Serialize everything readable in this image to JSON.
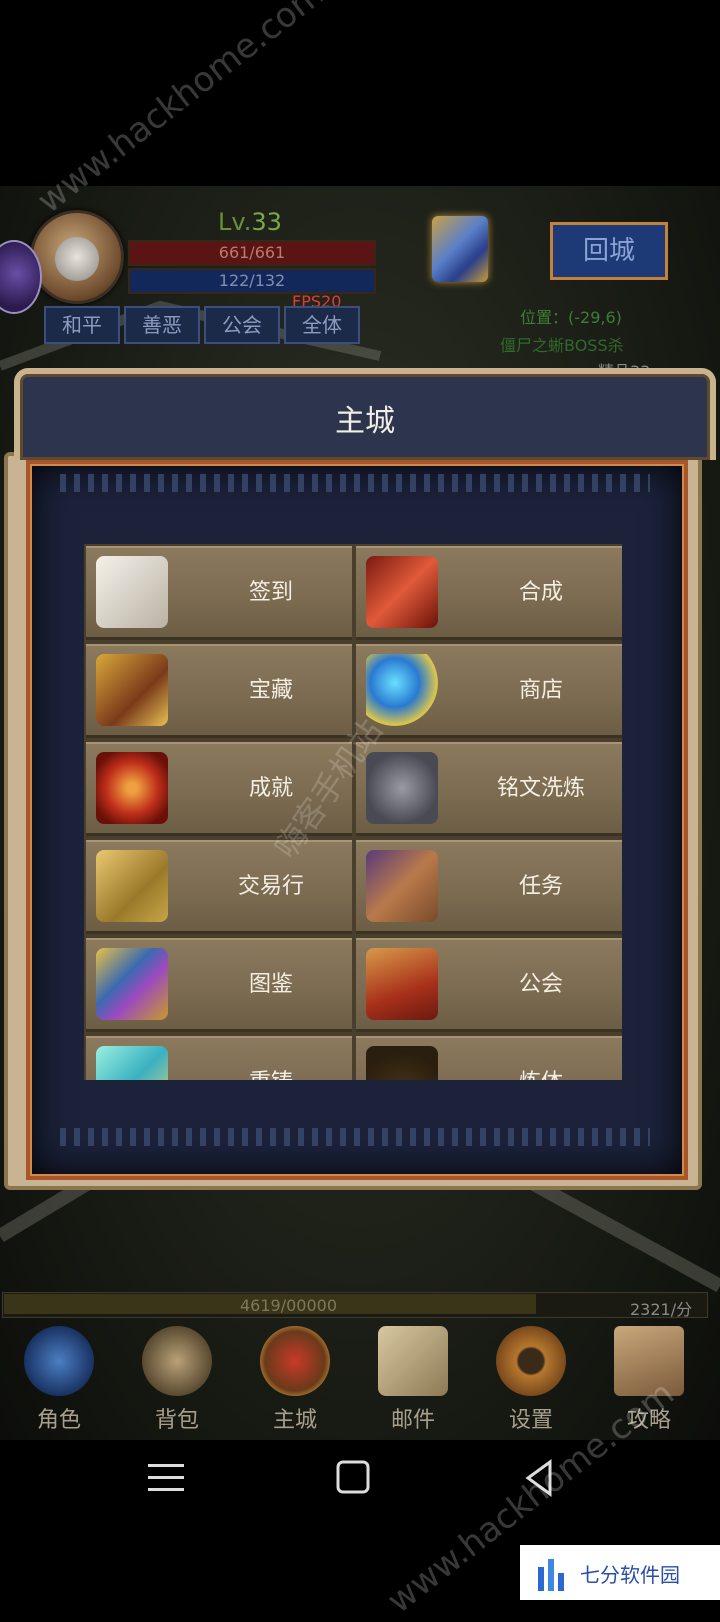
{
  "hud": {
    "level_prefix": "Lv.",
    "level_value": "33",
    "hp": "661/661",
    "mp": "122/132",
    "fps": "FPS20",
    "modes": [
      "和平",
      "善恶",
      "公会",
      "全体"
    ],
    "return_button": "回城",
    "position": "位置：(-29,6)",
    "boss_text": "僵尸之蜥BOSS杀",
    "right_hint": "精品33"
  },
  "modal": {
    "title": "主城",
    "items": [
      {
        "label": "签到",
        "icon": "quill-scroll-icon"
      },
      {
        "label": "合成",
        "icon": "red-blade-icon"
      },
      {
        "label": "宝藏",
        "icon": "treasure-chest-icon"
      },
      {
        "label": "商店",
        "icon": "gems-icon"
      },
      {
        "label": "成就",
        "icon": "pentagram-scroll-icon"
      },
      {
        "label": "铭文洗炼",
        "icon": "rune-stone-icon"
      },
      {
        "label": "交易行",
        "icon": "gold-ingots-icon"
      },
      {
        "label": "任务",
        "icon": "quest-scroll-icon"
      },
      {
        "label": "图鉴",
        "icon": "golden-book-icon"
      },
      {
        "label": "公会",
        "icon": "guild-banner-icon"
      },
      {
        "label": "重铸",
        "icon": "crystal-sword-icon"
      },
      {
        "label": "炼体",
        "icon": "meditation-figure-icon"
      }
    ]
  },
  "exp": {
    "text": "4619/00000",
    "score": "2321/分",
    "fill_fraction": 0.76
  },
  "nav": [
    {
      "label": "角色",
      "icon": "character-icon"
    },
    {
      "label": "背包",
      "icon": "bag-icon"
    },
    {
      "label": "主城",
      "icon": "castle-shield-icon"
    },
    {
      "label": "邮件",
      "icon": "mail-icon"
    },
    {
      "label": "设置",
      "icon": "settings-gear-icon"
    },
    {
      "label": "攻略",
      "icon": "guide-scroll-icon"
    }
  ],
  "watermarks": {
    "url": "www.hackhome.com",
    "cn": "嗨客手机站",
    "site": "七分软件园"
  },
  "colors": {
    "panel": "#1b223a",
    "tile": "#7a6a50",
    "accent": "#c4833a"
  }
}
